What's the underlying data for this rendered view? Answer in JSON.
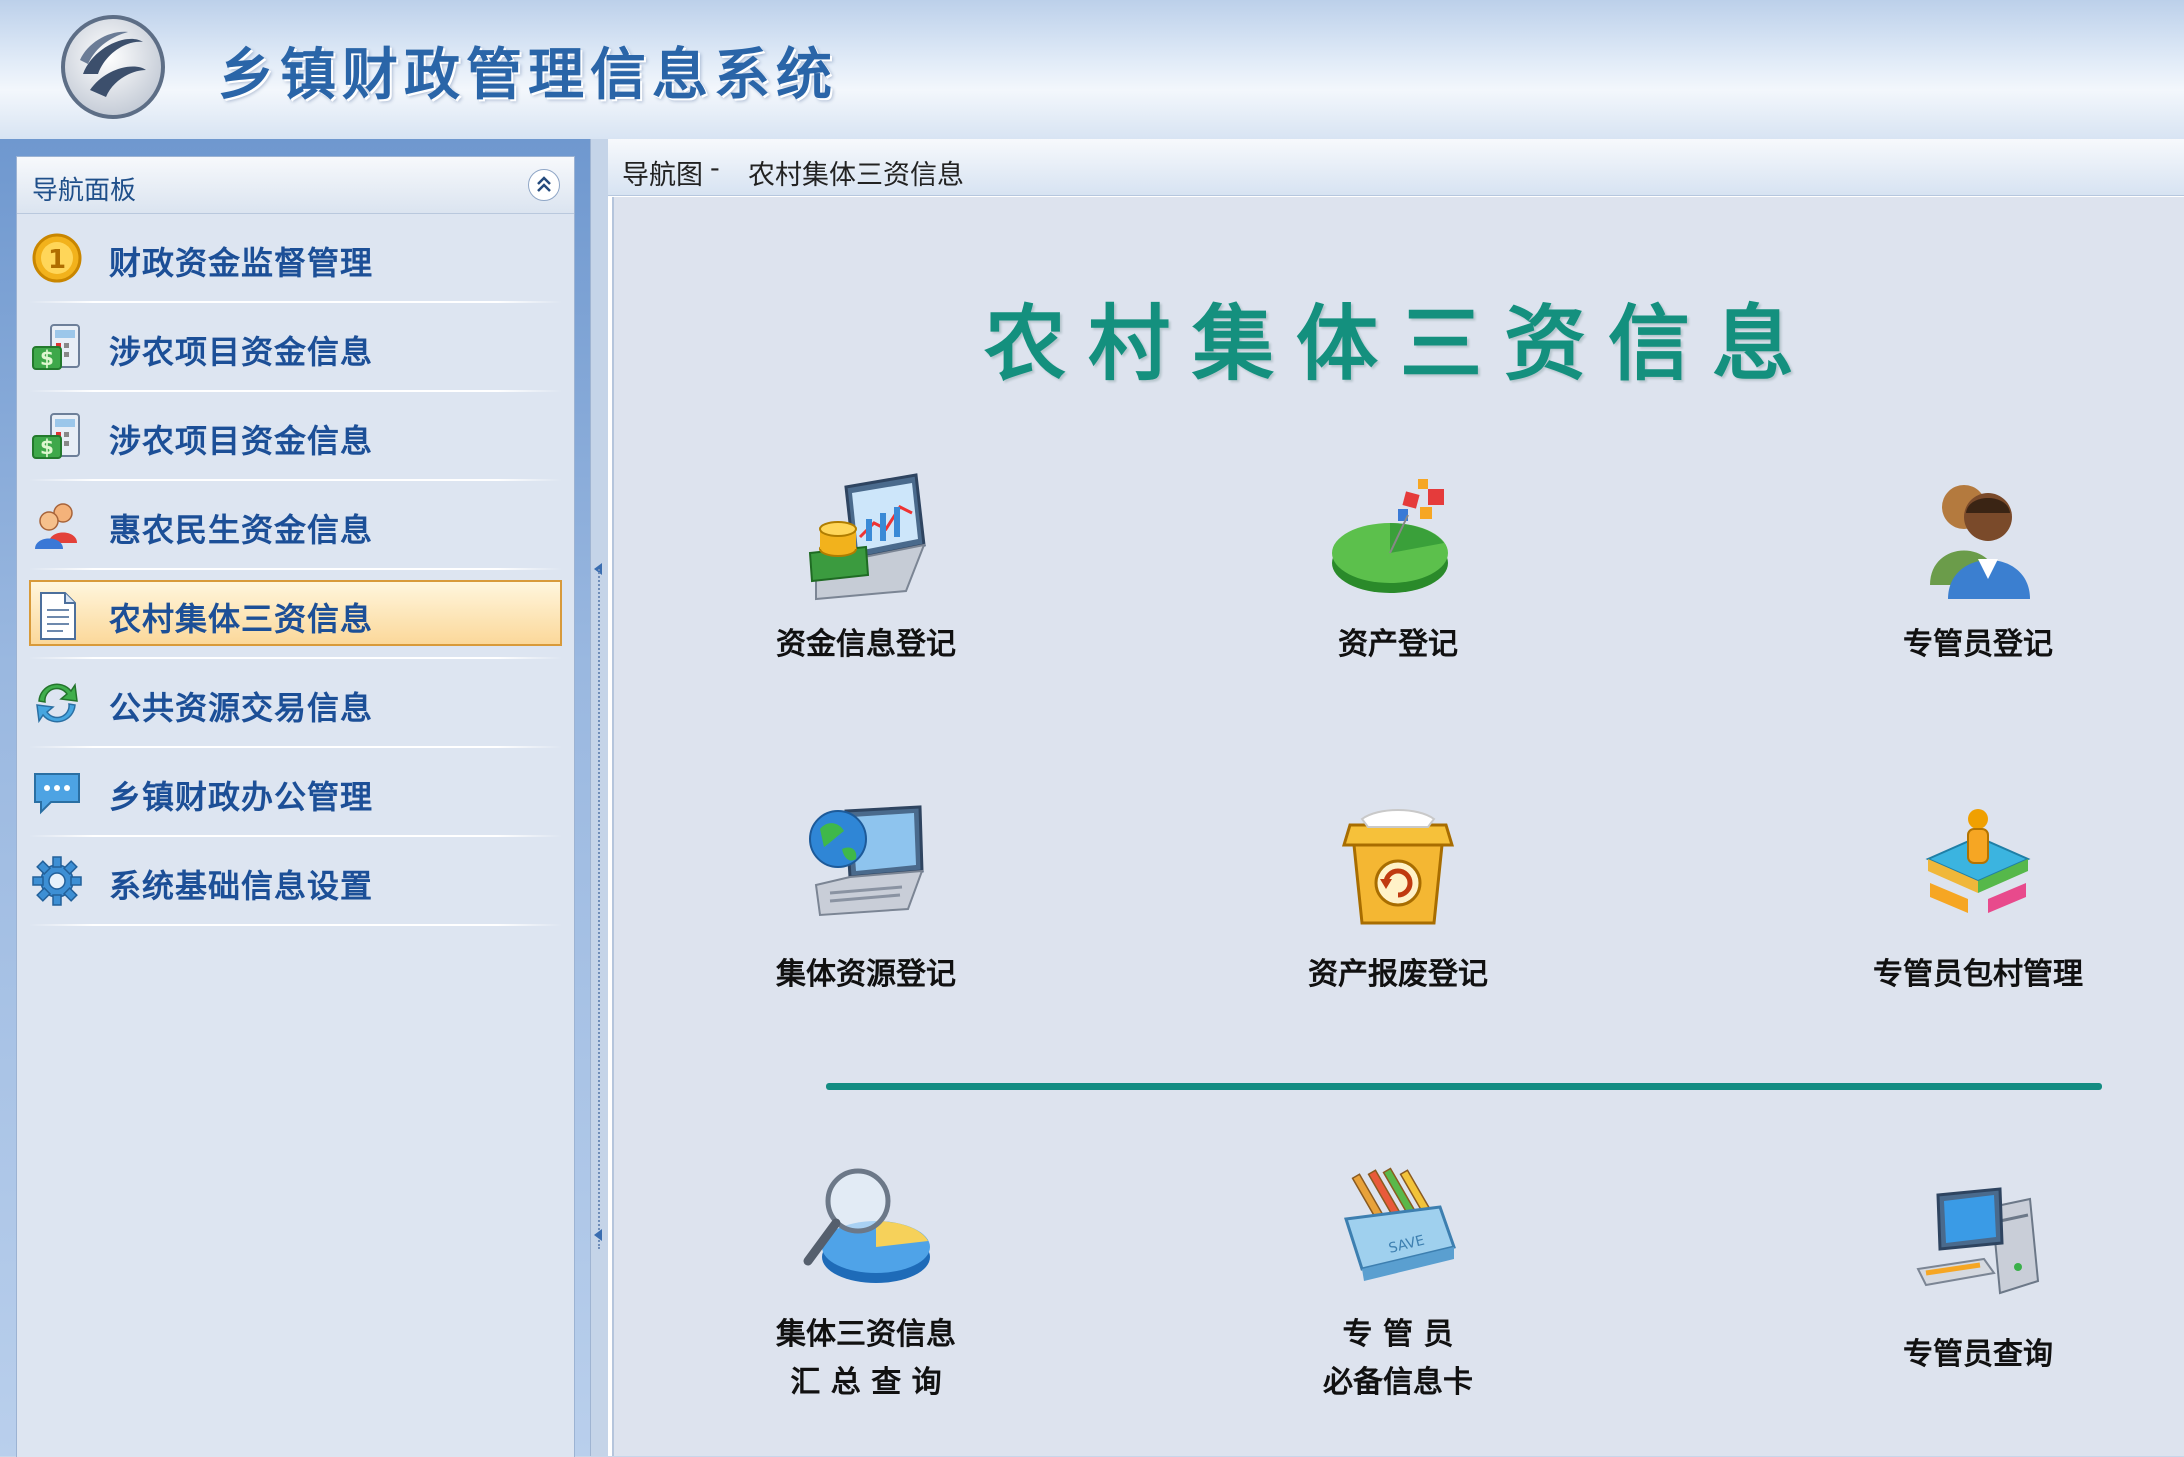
{
  "header": {
    "title": "乡镇财政管理信息系统",
    "logo": "swirl-logo"
  },
  "sidebar": {
    "panel_title": "导航面板",
    "collapse_icon": "double-chevron-up-icon",
    "items": [
      {
        "label": "财政资金监督管理",
        "icon": "gold-coin-icon",
        "active": false
      },
      {
        "label": "涉农项目资金信息",
        "icon": "money-calculator-icon",
        "active": false
      },
      {
        "label": "涉农项目资金信息",
        "icon": "money-calculator-icon",
        "active": false
      },
      {
        "label": "惠农民生资金信息",
        "icon": "users-icon",
        "active": false
      },
      {
        "label": "农村集体三资信息",
        "icon": "document-icon",
        "active": true
      },
      {
        "label": "公共资源交易信息",
        "icon": "refresh-icon",
        "active": false
      },
      {
        "label": "乡镇财政办公管理",
        "icon": "chat-bubble-icon",
        "active": false
      },
      {
        "label": "系统基础信息设置",
        "icon": "gear-icon",
        "active": false
      }
    ]
  },
  "breadcrumb": {
    "root": "导航图",
    "separator": "-",
    "current": "农村集体三资信息"
  },
  "main": {
    "heading": "农村集体三资信息",
    "tiles": [
      {
        "label": "资金信息登记",
        "icon": "laptop-coins-icon"
      },
      {
        "label": "资产登记",
        "icon": "pie-chart-icon"
      },
      {
        "label": "专管员登记",
        "icon": "people-icon"
      },
      {
        "label": "集体资源登记",
        "icon": "globe-laptop-icon"
      },
      {
        "label": "资产报废登记",
        "icon": "recycle-box-icon"
      },
      {
        "label": "专管员包村管理",
        "icon": "puzzle-person-icon"
      },
      {
        "label_line1": "集体三资信息",
        "label_line2": "汇 总 查 询",
        "icon": "magnifier-pie-icon"
      },
      {
        "label_line1": "专 管 员",
        "label_line2": "必备信息卡",
        "icon": "file-tray-icon"
      },
      {
        "label": "专管员查询",
        "icon": "computer-tower-icon"
      }
    ]
  },
  "colors": {
    "heading": "#14907e",
    "nav_text": "#1c4f97",
    "divider": "#138c82",
    "active_bg": "#fbd89a"
  }
}
